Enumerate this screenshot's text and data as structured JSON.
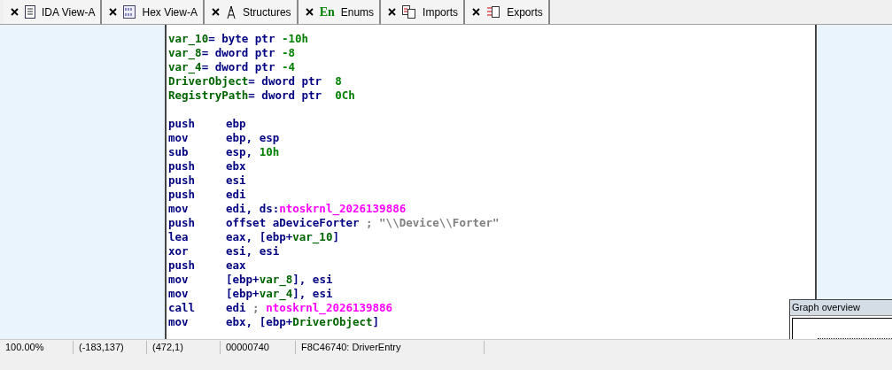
{
  "tabs": [
    {
      "label": "IDA View-A",
      "kind": "document"
    },
    {
      "label": "Hex View-A",
      "kind": "hex"
    },
    {
      "label": "Structures",
      "kind": "structure"
    },
    {
      "label": "Enums",
      "kind": "enum",
      "icon_text": "En"
    },
    {
      "label": "Imports",
      "kind": "imports"
    },
    {
      "label": "Exports",
      "kind": "exports"
    }
  ],
  "code_lines": [
    {
      "kind": "declaration",
      "segments": [
        {
          "text": "var_10",
          "kind": "var"
        },
        {
          "text": "= byte ptr ",
          "kind": "plain"
        },
        {
          "text": "-10h",
          "kind": "number"
        }
      ]
    },
    {
      "kind": "declaration",
      "segments": [
        {
          "text": "var_8",
          "kind": "var"
        },
        {
          "text": "= dword ptr ",
          "kind": "plain"
        },
        {
          "text": "-8",
          "kind": "number"
        }
      ]
    },
    {
      "kind": "declaration",
      "segments": [
        {
          "text": "var_4",
          "kind": "var"
        },
        {
          "text": "= dword ptr ",
          "kind": "plain"
        },
        {
          "text": "-4",
          "kind": "number"
        }
      ]
    },
    {
      "kind": "declaration",
      "segments": [
        {
          "text": "DriverObject",
          "kind": "var"
        },
        {
          "text": "= dword ptr  ",
          "kind": "plain"
        },
        {
          "text": "8",
          "kind": "number"
        }
      ]
    },
    {
      "kind": "declaration",
      "segments": [
        {
          "text": "RegistryPath",
          "kind": "var"
        },
        {
          "text": "= dword ptr  ",
          "kind": "plain"
        },
        {
          "text": "0Ch",
          "kind": "number"
        }
      ]
    },
    {
      "kind": "blank"
    },
    {
      "kind": "instruction",
      "mnemonic": "push",
      "segments": [
        {
          "text": "ebp",
          "kind": "plain"
        }
      ]
    },
    {
      "kind": "instruction",
      "mnemonic": "mov",
      "segments": [
        {
          "text": "ebp, esp",
          "kind": "plain"
        }
      ]
    },
    {
      "kind": "instruction",
      "mnemonic": "sub",
      "segments": [
        {
          "text": "esp, ",
          "kind": "plain"
        },
        {
          "text": "10h",
          "kind": "number"
        }
      ]
    },
    {
      "kind": "instruction",
      "mnemonic": "push",
      "segments": [
        {
          "text": "ebx",
          "kind": "plain"
        }
      ]
    },
    {
      "kind": "instruction",
      "mnemonic": "push",
      "segments": [
        {
          "text": "esi",
          "kind": "plain"
        }
      ]
    },
    {
      "kind": "instruction",
      "mnemonic": "push",
      "segments": [
        {
          "text": "edi",
          "kind": "plain"
        }
      ]
    },
    {
      "kind": "instruction",
      "mnemonic": "mov",
      "segments": [
        {
          "text": "edi, ds:",
          "kind": "plain"
        },
        {
          "text": "ntoskrnl_2026139886",
          "kind": "import"
        }
      ]
    },
    {
      "kind": "instruction",
      "mnemonic": "push",
      "segments": [
        {
          "text": "offset aDeviceForter",
          "kind": "plain"
        },
        {
          "text": " ; \"\\\\Device\\\\Forter\"",
          "kind": "comment"
        }
      ]
    },
    {
      "kind": "instruction",
      "mnemonic": "lea",
      "segments": [
        {
          "text": "eax, [ebp+",
          "kind": "plain"
        },
        {
          "text": "var_10",
          "kind": "var"
        },
        {
          "text": "]",
          "kind": "plain"
        }
      ]
    },
    {
      "kind": "instruction",
      "mnemonic": "xor",
      "segments": [
        {
          "text": "esi, esi",
          "kind": "plain"
        }
      ]
    },
    {
      "kind": "instruction",
      "mnemonic": "push",
      "segments": [
        {
          "text": "eax",
          "kind": "plain"
        }
      ]
    },
    {
      "kind": "instruction",
      "mnemonic": "mov",
      "segments": [
        {
          "text": "[ebp+",
          "kind": "plain"
        },
        {
          "text": "var_8",
          "kind": "var"
        },
        {
          "text": "], esi",
          "kind": "plain"
        }
      ]
    },
    {
      "kind": "instruction",
      "mnemonic": "mov",
      "segments": [
        {
          "text": "[ebp+",
          "kind": "plain"
        },
        {
          "text": "var_4",
          "kind": "var"
        },
        {
          "text": "], esi",
          "kind": "plain"
        }
      ]
    },
    {
      "kind": "instruction",
      "mnemonic": "call",
      "segments": [
        {
          "text": "edi",
          "kind": "plain"
        },
        {
          "text": " ; ",
          "kind": "comment"
        },
        {
          "text": "ntoskrnl_2026139886",
          "kind": "import"
        }
      ]
    },
    {
      "kind": "instruction",
      "mnemonic": "mov",
      "segments": [
        {
          "text": "ebx, [ebp+",
          "kind": "plain"
        },
        {
          "text": "DriverObject",
          "kind": "var"
        },
        {
          "text": "]",
          "kind": "plain"
        }
      ]
    }
  ],
  "status_bar": [
    "100.00%",
    "(-183,137)",
    "(472,1)",
    "00000740",
    "F8C46740: DriverEntry"
  ],
  "graph_overview": {
    "title": "Graph overview"
  }
}
